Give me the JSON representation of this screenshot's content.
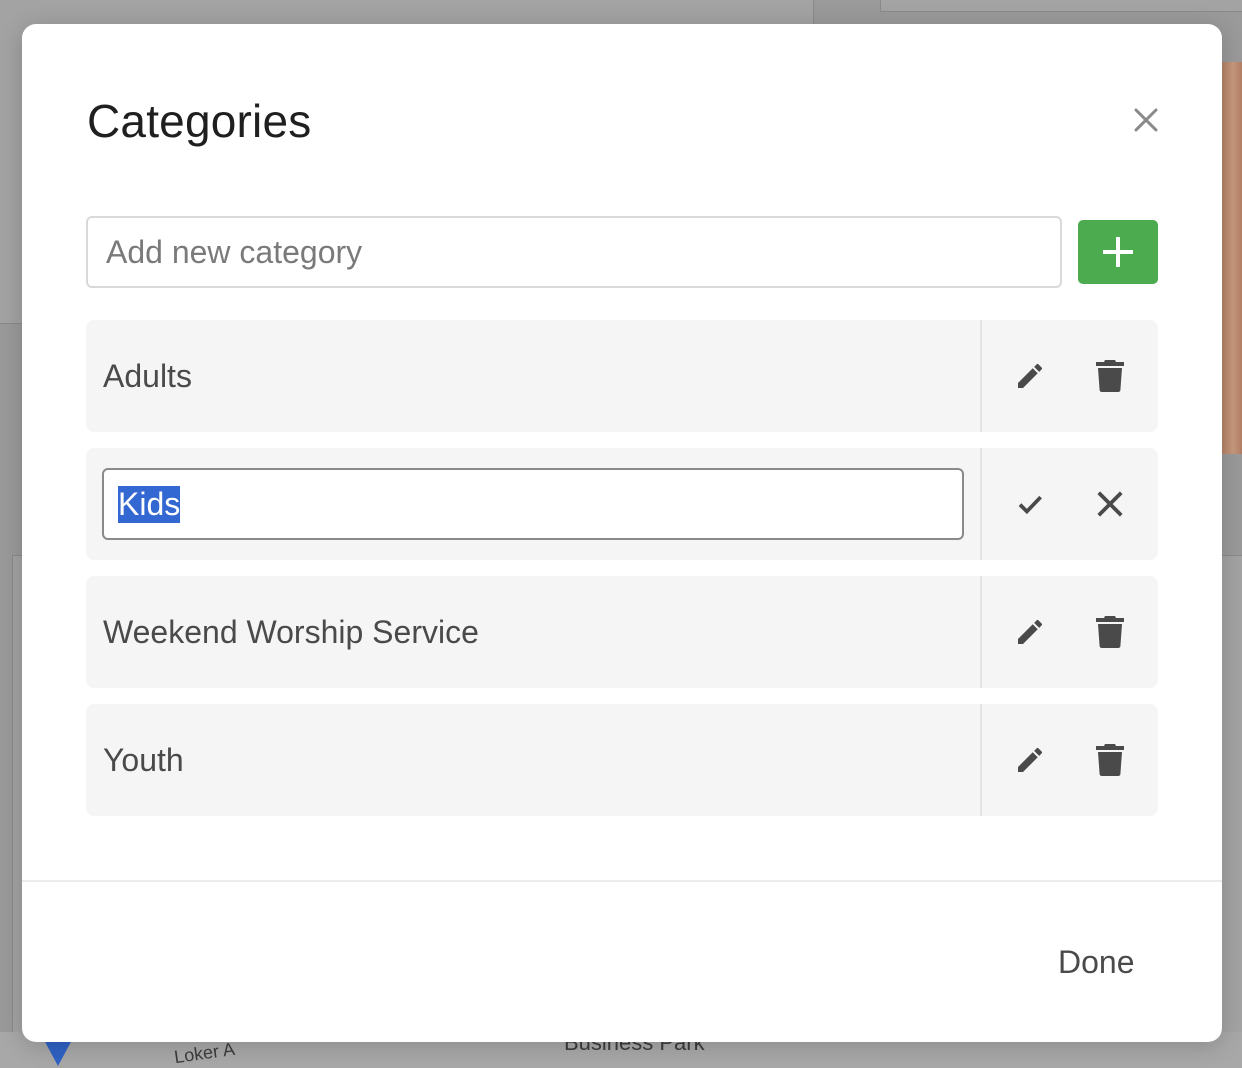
{
  "modal": {
    "title": "Categories",
    "close_icon": "close-icon",
    "add_input": {
      "placeholder": "Add new category",
      "value": ""
    },
    "add_button_icon": "plus-icon",
    "add_button_color": "#4caa4f",
    "categories": [
      {
        "label": "Adults",
        "editing": false
      },
      {
        "label": "Kids",
        "editing": true,
        "edit_value": "Kids",
        "selected_text": "Kids"
      },
      {
        "label": "Weekend Worship Service",
        "editing": false
      },
      {
        "label": "Youth",
        "editing": false
      }
    ],
    "row_actions": {
      "view": [
        "pencil-icon",
        "trash-icon"
      ],
      "edit": [
        "check-icon",
        "close-icon"
      ]
    },
    "done_label": "Done"
  },
  "background": {
    "map_labels": [
      "Loker A",
      "Business Park"
    ]
  }
}
